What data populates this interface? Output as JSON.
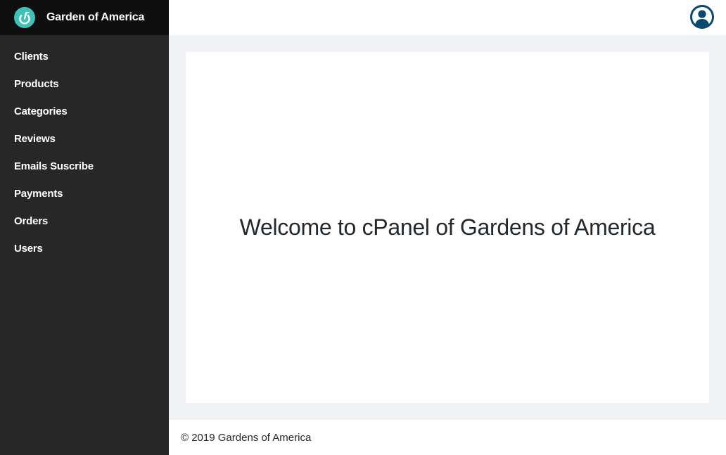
{
  "brand": {
    "name": "Garden of America",
    "logo_icon": "power-leaf-icon",
    "logo_color": "#3ec1b7"
  },
  "sidebar": {
    "items": [
      {
        "label": "Clients"
      },
      {
        "label": "Products"
      },
      {
        "label": "Categories"
      },
      {
        "label": "Reviews"
      },
      {
        "label": "Emails Suscribe"
      },
      {
        "label": "Payments"
      },
      {
        "label": "Orders"
      },
      {
        "label": "Users"
      }
    ]
  },
  "header": {
    "user_icon": "user-avatar-icon",
    "user_icon_color": "#074a6e"
  },
  "main": {
    "welcome_text": "Welcome to cPanel of Gardens of America"
  },
  "footer": {
    "copyright": "© 2019 Gardens of America"
  },
  "colors": {
    "sidebar_bg": "#272727",
    "brand_bg": "#0f0f0f",
    "content_bg": "#f1f2f6",
    "card_bg": "#ffffff"
  }
}
